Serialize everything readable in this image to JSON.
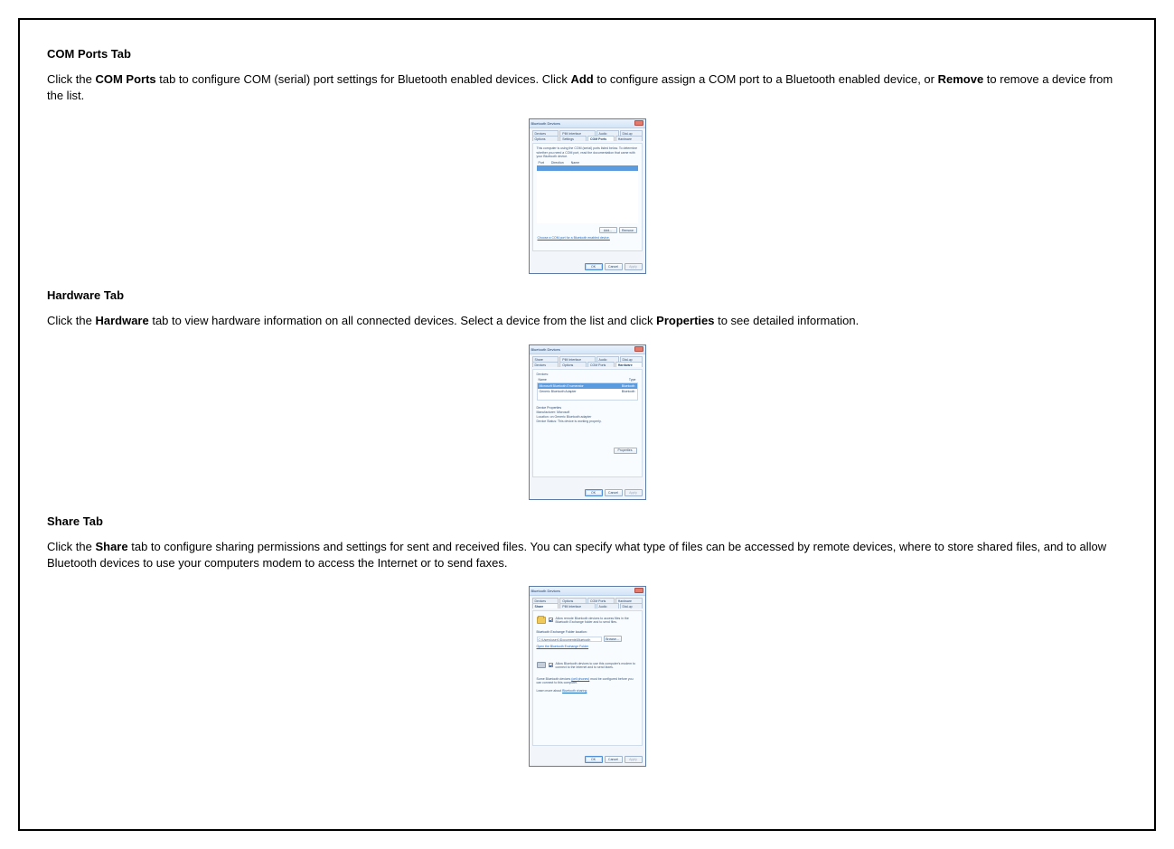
{
  "sections": {
    "comports": {
      "heading": "COM Ports Tab",
      "para_pre": "Click the ",
      "para_b1": "COM Ports",
      "para_mid1": " tab to configure COM (serial) port settings for Bluetooth enabled devices. Click ",
      "para_b2": "Add",
      "para_mid2": " to configure assign a COM port to a Bluetooth enabled device, or ",
      "para_b3": "Remove",
      "para_post": " to remove a device from the list."
    },
    "hardware": {
      "heading": "Hardware Tab",
      "para_pre": "Click the ",
      "para_b1": "Hardware",
      "para_mid1": " tab to view hardware information on all connected devices. Select a device from the list and click ",
      "para_b2": "Properties",
      "para_post": " to see detailed information."
    },
    "share": {
      "heading": "Share Tab",
      "para_pre": "Click the ",
      "para_b1": "Share",
      "para_post": " tab to configure sharing permissions and settings for sent and received files. You can specify what type of files can be accessed by remote devices, where to store shared files, and to allow Bluetooth devices to use your computers modem to access the Internet or to send faxes."
    }
  },
  "dialog": {
    "title": "Bluetooth Devices",
    "tabs": {
      "devices": "Devices",
      "pim": "PIM Interface",
      "audio": "Audio",
      "dialup": "Dial-up",
      "options": "Options",
      "settings": "Settings",
      "comports": "COM Ports",
      "hardware": "Hardware",
      "share": "Share"
    },
    "footer": {
      "ok": "OK",
      "cancel": "Cancel",
      "apply": "Apply"
    },
    "comports_body": {
      "intro": "This computer is using the COM (serial) ports listed below. To determine whether you need a COM port, read the documentation that came with your Bluetooth device.",
      "columns": {
        "port": "Port",
        "direction": "Direction",
        "name": "Name"
      },
      "buttons": {
        "add": "Add...",
        "remove": "Remove"
      },
      "link": "Choose a COM port for a Bluetooth enabled device."
    },
    "hardware_body": {
      "label_devices": "Devices:",
      "columns": {
        "name": "Name",
        "type": "Type"
      },
      "row1": {
        "name": "Microsoft Bluetooth Enumerator",
        "type": "Bluetooth"
      },
      "row2": {
        "name": "Generic Bluetooth Adapter",
        "type": "Bluetooth"
      },
      "props_label": "Device Properties",
      "prop1": "Manufacturer: Microsoft",
      "prop2": "Location: on Generic Bluetooth adapter",
      "prop3": "Device Status: This device is working properly.",
      "button": "Properties"
    },
    "share_body": {
      "check1": "Allow remote Bluetooth devices to access files in the Bluetooth Exchange folder and to send files.",
      "section_label": "Bluetooth Exchange Folder location:",
      "path": "C:\\Users\\user1\\Documents\\Bluetooth Exchange",
      "browse": "Browse...",
      "link1": "Open the Bluetooth Exchange Folder",
      "check2": "Allow Bluetooth devices to use this computer's modem to connect to the Internet and to send faxes.",
      "note_pre": "Some Bluetooth devices ",
      "note_link": "(cell phones)",
      "note_post": " must be configured before you can connect to this computer.",
      "link2_label": "Learn more about ",
      "link2": "Bluetooth sharing"
    }
  }
}
